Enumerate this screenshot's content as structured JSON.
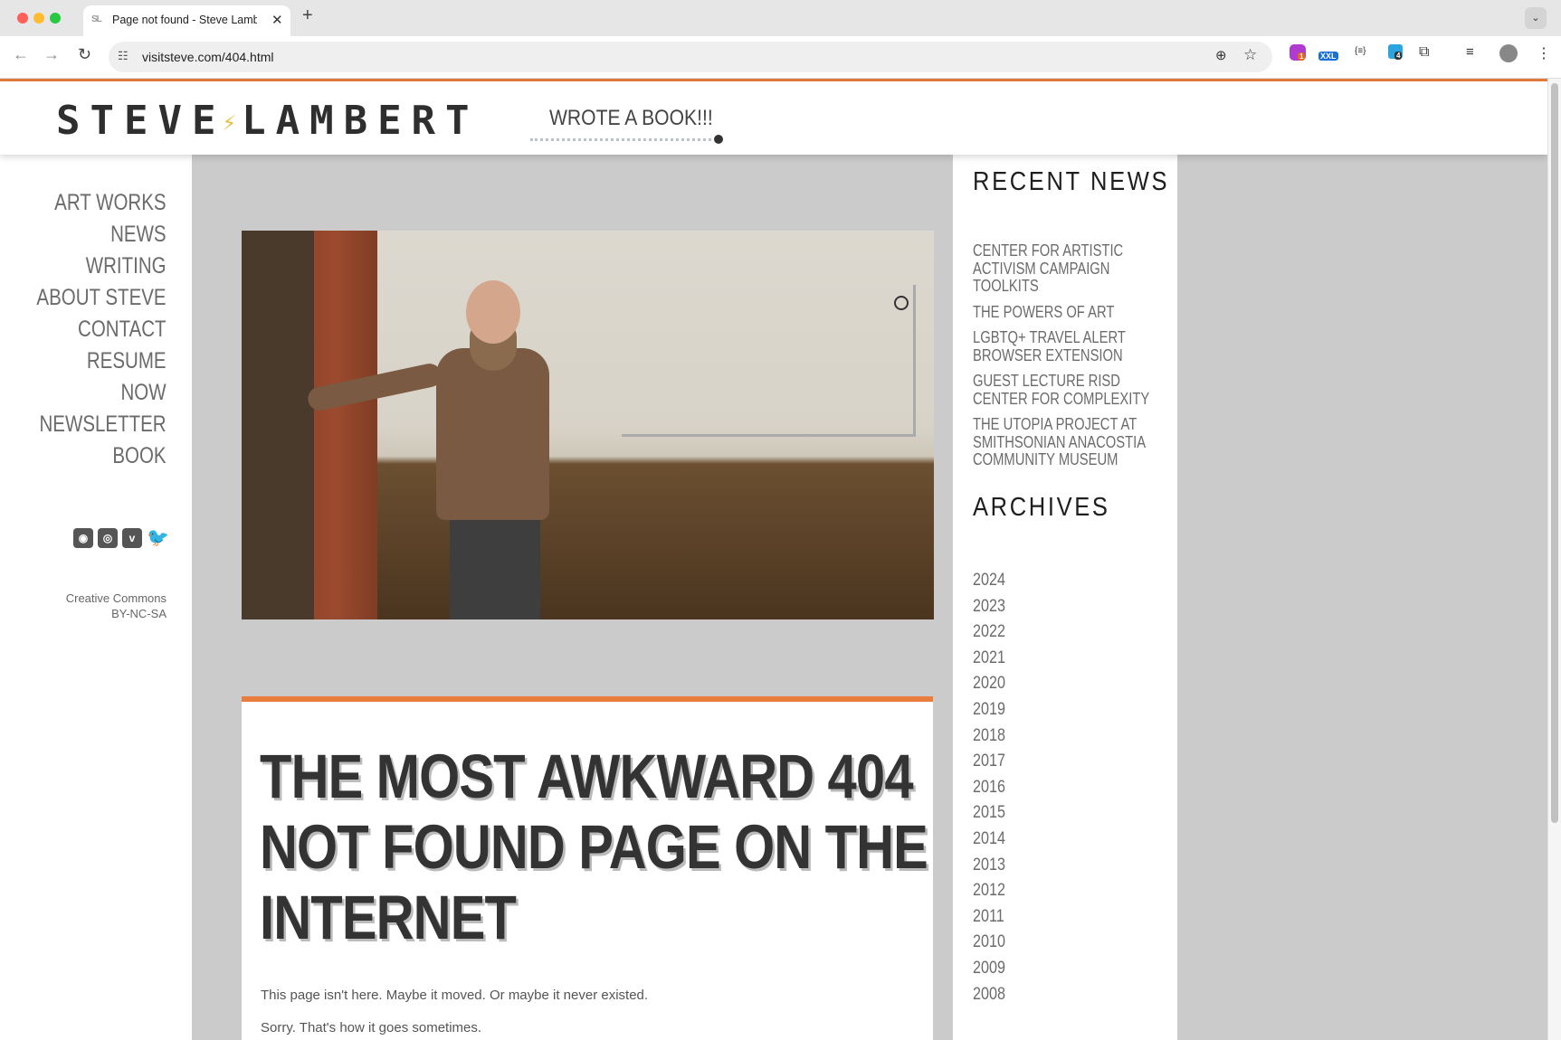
{
  "browser": {
    "tab_title": "Page not found - Steve Lambert",
    "tab_favicon": "SL",
    "url": "visitsteve.com/404.html",
    "extensions": {
      "ext1_badge": "1",
      "ext2_label": "XXL",
      "ext3_label": "{≡}",
      "ext4_badge": "4"
    },
    "colors": {
      "close": "#ff5f57",
      "minimize": "#febc2e",
      "maximize": "#28c840"
    }
  },
  "header": {
    "logo": "STEVE LAMBERT",
    "logo_bolt": "⚡",
    "tagline": "WROTE A BOOK!!!"
  },
  "nav": {
    "items": [
      "ART WORKS",
      "NEWS",
      "WRITING",
      "ABOUT STEVE",
      "CONTACT",
      "RESUME",
      "NOW",
      "NEWSLETTER",
      "BOOK"
    ]
  },
  "social": {
    "rss": "rss-icon",
    "instagram": "instagram-icon",
    "vimeo": "vimeo-icon",
    "twitter": "twitter-icon"
  },
  "license": {
    "line1": "Creative Commons",
    "line2": "BY-NC-SA"
  },
  "article": {
    "title": "THE MOST AWKWARD 404 NOT FOUND PAGE ON THE INTERNET",
    "title_lines": [
      "THE MOST AWKWARD 404",
      "NOT FOUND PAGE ON THE",
      "INTERNET"
    ],
    "p1": "This page isn't here. Maybe it moved. Or maybe it never existed.",
    "p2": "Sorry. That's how it goes sometimes."
  },
  "sidebar": {
    "recent_heading": "RECENT NEWS",
    "recent": [
      [
        "CENTER FOR ARTISTIC",
        "ACTIVISM CAMPAIGN",
        "TOOLKITS"
      ],
      [
        "THE POWERS OF ART"
      ],
      [
        "LGBTQ+ TRAVEL ALERT",
        "BROWSER EXTENSION"
      ],
      [
        "GUEST LECTURE RISD",
        "CENTER FOR COMPLEXITY"
      ],
      [
        "THE UTOPIA PROJECT AT",
        "SMITHSONIAN ANACOSTIA",
        "COMMUNITY MUSEUM"
      ]
    ],
    "archives_heading": "ARCHIVES",
    "archives": [
      "2024",
      "2023",
      "2022",
      "2021",
      "2020",
      "2019",
      "2018",
      "2017",
      "2016",
      "2015",
      "2014",
      "2013",
      "2012",
      "2011",
      "2010",
      "2009",
      "2008"
    ]
  },
  "colors": {
    "accent": "#e87d3e",
    "page_bg": "#cbcbcb",
    "text_dark": "#333333"
  }
}
